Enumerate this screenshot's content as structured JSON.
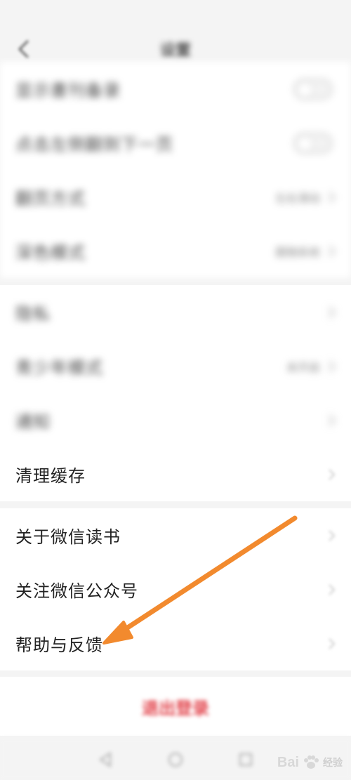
{
  "status_bar": {
    "left": "",
    "right": ""
  },
  "nav": {
    "title": "设置",
    "back_icon": "chevron-left-icon"
  },
  "groups": {
    "reading": {
      "items": [
        {
          "label": "显示書刊备录",
          "control": "toggle",
          "on": false
        },
        {
          "label": "点击左侧翻到下一页",
          "control": "toggle",
          "on": false
        },
        {
          "label": "翻页方式",
          "control": "value",
          "value": "左右滑动"
        },
        {
          "label": "深色模式",
          "control": "value",
          "value": "跟随系统"
        }
      ]
    },
    "privacy": {
      "items": [
        {
          "label": "隐私",
          "control": "chevron"
        },
        {
          "label": "青少年模式",
          "control": "value",
          "value": "未开启"
        },
        {
          "label": "通知",
          "control": "chevron"
        },
        {
          "label": "清理缓存",
          "control": "chevron"
        }
      ]
    },
    "about": {
      "items": [
        {
          "label": "关于微信读书",
          "control": "chevron"
        },
        {
          "label": "关注微信公众号",
          "control": "chevron"
        },
        {
          "label": "帮助与反馈",
          "control": "chevron"
        }
      ]
    }
  },
  "logout": {
    "label": "退出登录"
  },
  "bottom_nav": [
    "back-triangle-icon",
    "home-circle-icon",
    "recents-square-icon"
  ],
  "annotation": {
    "color": "#f28a2e",
    "points_to": "帮助与反馈"
  },
  "watermark": {
    "brand": "Bai",
    "suffix": "经验"
  },
  "colors": {
    "accent_red": "#e2434b",
    "arrow_orange": "#f28a2e",
    "background": "#f4f4f4"
  }
}
